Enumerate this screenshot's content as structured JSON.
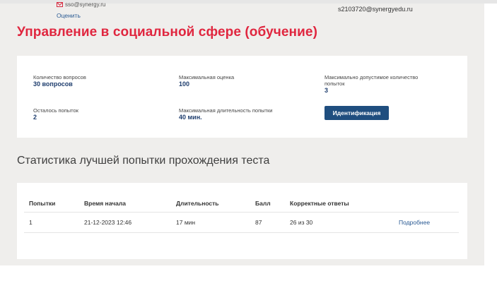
{
  "header": {
    "top_email": "sso@synergy.ru",
    "rate_link": "Оценить",
    "user_email": "s2103720@synergyedu.ru"
  },
  "page_title": "Управление в социальной сфере (обучение)",
  "info": {
    "questions_label": "Количество вопросов",
    "questions_value": "30 вопросов",
    "max_score_label": "Максимальная оценка",
    "max_score_value": "100",
    "max_attempts_label": "Максимально допустимое количество попыток",
    "max_attempts_value": "3",
    "remaining_label": "Осталось попыток",
    "remaining_value": "2",
    "max_duration_label": "Максимальная длительность попытки",
    "max_duration_value": "40 мин.",
    "identify_button": "Идентификация"
  },
  "stats": {
    "title": "Статистика лучшей попытки прохождения теста",
    "columns": [
      "Попытки",
      "Время начала",
      "Длительность",
      "Балл",
      "Корректные ответы"
    ],
    "rows": [
      {
        "attempt": "1",
        "start": "21-12-2023 12:46",
        "duration": "17 мин",
        "score": "87",
        "correct": "26 из 30",
        "details": "Подробнее"
      }
    ]
  },
  "colors": {
    "title_red": "#e0263f",
    "button_blue": "#1f4e7f",
    "value_blue": "#1f3e6e",
    "link_blue": "#2a5a93",
    "page_bg": "#efeeec"
  }
}
